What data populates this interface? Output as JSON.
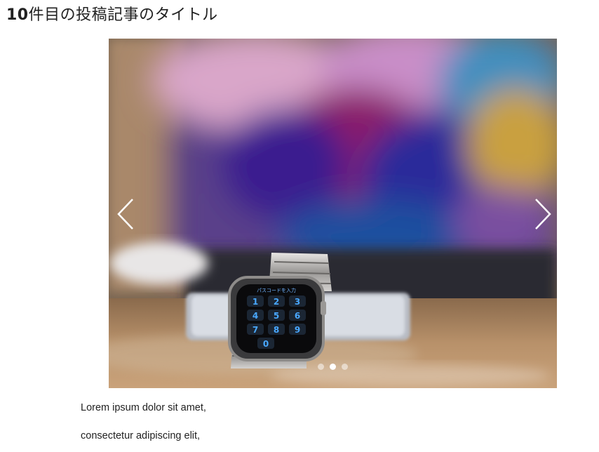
{
  "post": {
    "title_number": "10",
    "title_rest": "件目の投稿記事のタイトル",
    "paragraphs": [
      "Lorem ipsum dolor sit amet,",
      "consectetur adipiscing elit,"
    ]
  },
  "slider": {
    "photo_subject": "apple-watch-passcode-screen",
    "watch_screen_title": "パスコードを入力",
    "keypad_digits": [
      "1",
      "2",
      "3",
      "4",
      "5",
      "6",
      "7",
      "8",
      "9",
      "0"
    ],
    "dots_total": 3,
    "active_dot": 2,
    "prev_icon": "chevron-left-icon",
    "next_icon": "chevron-right-icon"
  }
}
